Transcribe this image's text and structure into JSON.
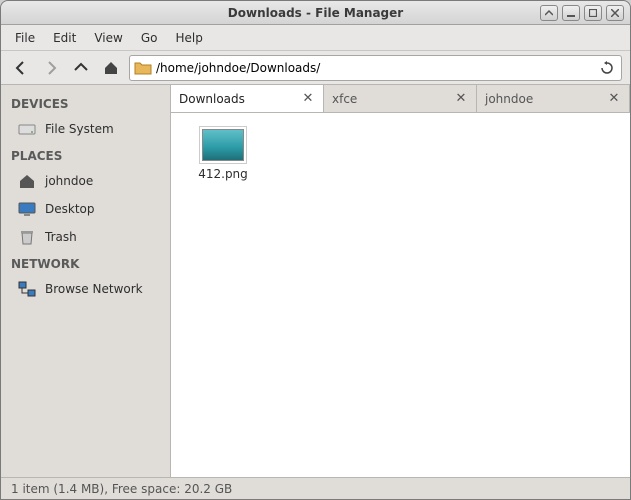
{
  "window": {
    "title": "Downloads - File Manager"
  },
  "menubar": {
    "file": "File",
    "edit": "Edit",
    "view": "View",
    "go": "Go",
    "help": "Help"
  },
  "toolbar": {
    "path": "/home/johndoe/Downloads/"
  },
  "sidebar": {
    "devices_heading": "DEVICES",
    "places_heading": "PLACES",
    "network_heading": "NETWORK",
    "file_system": "File System",
    "johndoe": "johndoe",
    "desktop": "Desktop",
    "trash": "Trash",
    "browse_network": "Browse Network"
  },
  "tabs": [
    {
      "label": "Downloads",
      "active": true
    },
    {
      "label": "xfce",
      "active": false
    },
    {
      "label": "johndoe",
      "active": false
    }
  ],
  "files": [
    {
      "name": "412.png"
    }
  ],
  "status": "1 item (1.4 MB), Free space: 20.2 GB"
}
